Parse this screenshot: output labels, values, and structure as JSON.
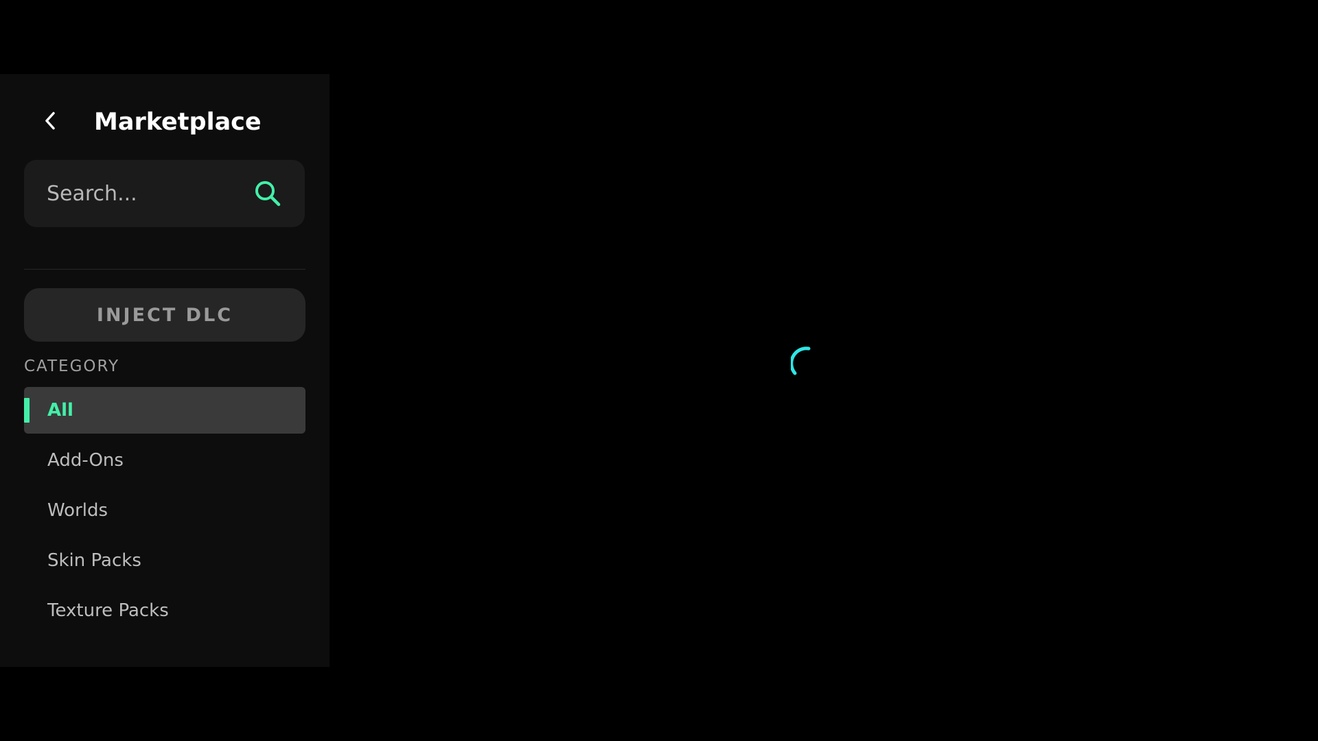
{
  "sidebar": {
    "title": "Marketplace",
    "back_icon": "chevron-left-icon",
    "search": {
      "placeholder": "Search...",
      "value": "",
      "icon": "search-icon"
    },
    "inject_label": "INJECT DLC",
    "category_heading": "CATEGORY",
    "categories": [
      {
        "label": "All",
        "active": true
      },
      {
        "label": "Add-Ons",
        "active": false
      },
      {
        "label": "Worlds",
        "active": false
      },
      {
        "label": "Skin Packs",
        "active": false
      },
      {
        "label": "Texture Packs",
        "active": false
      }
    ]
  },
  "main": {
    "loading": true,
    "spinner_icon": "loading-spinner-icon"
  },
  "colors": {
    "background": "#000000",
    "sidebar_bg": "#0d0d0d",
    "accent": "#43f0a8",
    "spinner": "#2ee6e6",
    "active_item_bg": "#3a3a3a",
    "button_bg": "#262626"
  }
}
